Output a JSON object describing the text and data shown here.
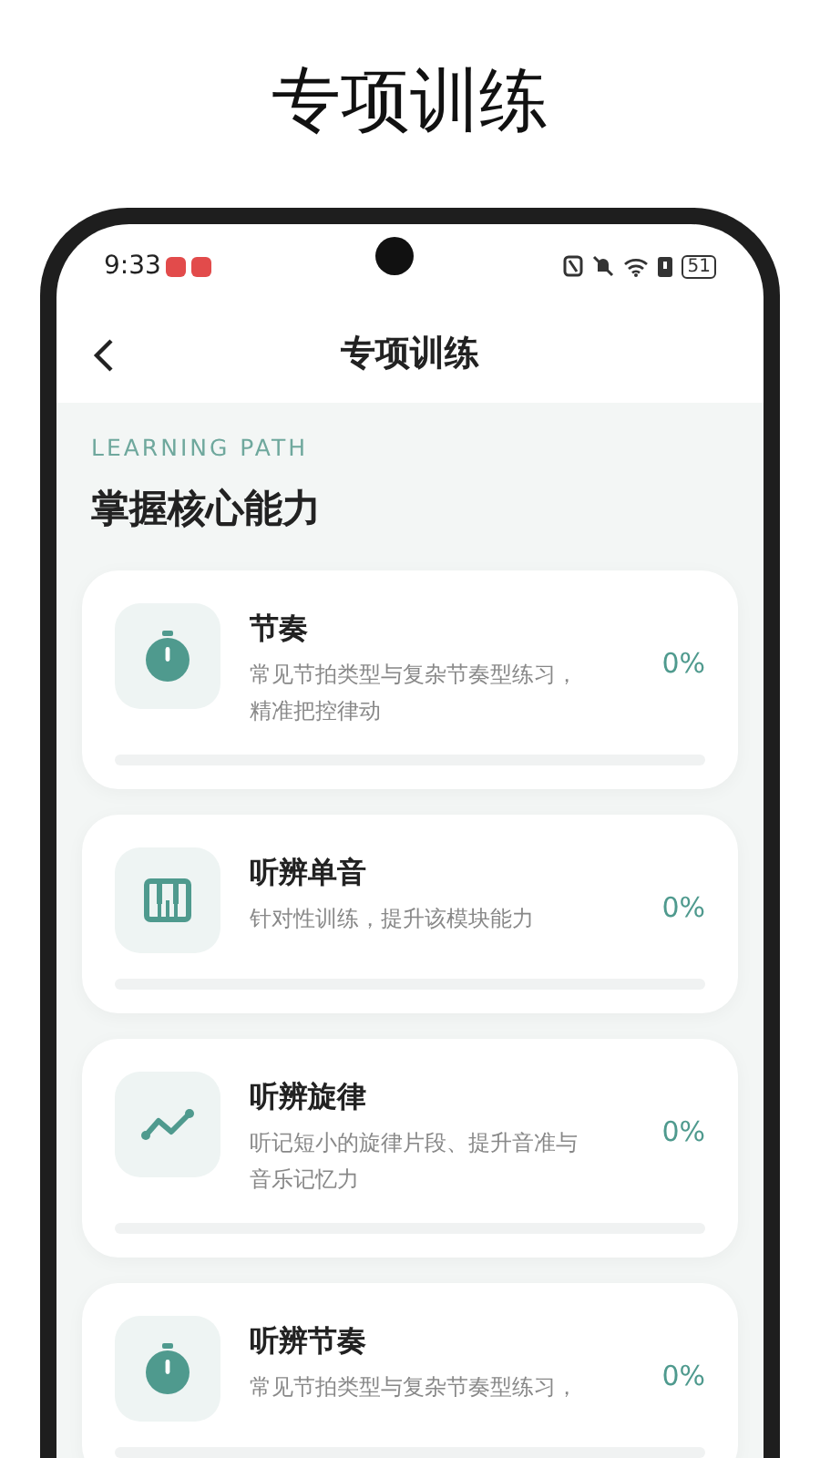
{
  "headline": "专项训练",
  "status_bar": {
    "time": "9:33",
    "battery": "51"
  },
  "header": {
    "title": "专项训练"
  },
  "section": {
    "eyebrow": "LEARNING PATH",
    "title": "掌握核心能力"
  },
  "modules": [
    {
      "kind": "stopwatch",
      "title": "节奏",
      "description": "常见节拍类型与复杂节奏型练习，精准把控律动",
      "percent": "0%",
      "level": 0
    },
    {
      "kind": "piano",
      "title": "听辨单音",
      "description": "针对性训练，提升该模块能力",
      "percent": "0%",
      "level": 0
    },
    {
      "kind": "trend",
      "title": "听辨旋律",
      "description": "听记短小的旋律片段、提升音准与音乐记忆力",
      "percent": "0%",
      "level": 0
    },
    {
      "kind": "stopwatch",
      "title": "听辨节奏",
      "description": "常见节拍类型与复杂节奏型练习，",
      "percent": "0%",
      "level": 0
    }
  ]
}
